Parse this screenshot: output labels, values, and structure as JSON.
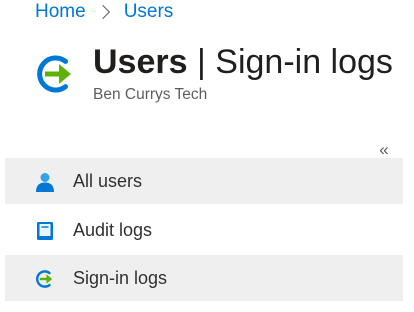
{
  "breadcrumb": {
    "home": "Home",
    "current": "Users"
  },
  "header": {
    "icon": "sign-in-arrow-icon",
    "title_bold": "Users",
    "title_separator": "|",
    "title_rest": "Sign-in logs",
    "subtitle": "Ben Currys Tech"
  },
  "sidebar": {
    "collapse_glyph": "«",
    "items": [
      {
        "label": "All users",
        "icon": "user-icon",
        "selected": false
      },
      {
        "label": "Audit logs",
        "icon": "book-icon",
        "selected": false
      },
      {
        "label": "Sign-in logs",
        "icon": "sign-in-arrow-icon",
        "selected": true
      }
    ]
  },
  "colors": {
    "link": "#0078d4",
    "hover_bg": "#f0efef",
    "accent_green": "#5db300"
  }
}
